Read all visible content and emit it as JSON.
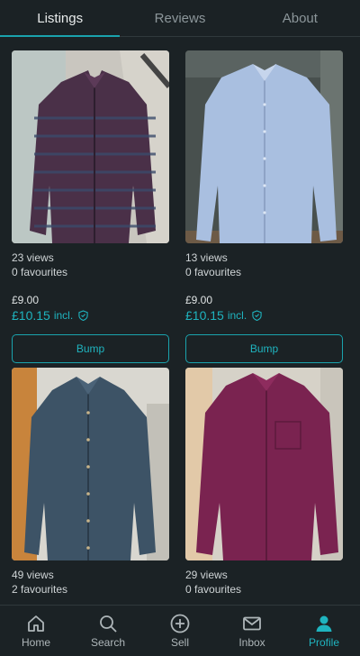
{
  "tabs": [
    {
      "label": "Listings",
      "active": true
    },
    {
      "label": "Reviews",
      "active": false
    },
    {
      "label": "About",
      "active": false
    }
  ],
  "listings": [
    {
      "views": "23 views",
      "favourites": "0 favourites",
      "price": "£9.00",
      "price_incl": "£10.15",
      "incl_label": "incl.",
      "bump_label": "Bump",
      "image": "shirt-burgundy-check",
      "shirt_color": "#4a3048"
    },
    {
      "views": "13 views",
      "favourites": "0 favourites",
      "price": "£9.00",
      "price_incl": "£10.15",
      "incl_label": "incl.",
      "bump_label": "Bump",
      "image": "shirt-light-blue",
      "shirt_color": "#a9bfe0"
    },
    {
      "views": "49 views",
      "favourites": "2 favourites",
      "image": "shirt-denim",
      "shirt_color": "#3d5366"
    },
    {
      "views": "29 views",
      "favourites": "0 favourites",
      "image": "shirt-magenta",
      "shirt_color": "#7a2350"
    }
  ],
  "nav": [
    {
      "label": "Home",
      "icon": "home-icon",
      "active": false
    },
    {
      "label": "Search",
      "icon": "search-icon",
      "active": false
    },
    {
      "label": "Sell",
      "icon": "plus-circle-icon",
      "active": false
    },
    {
      "label": "Inbox",
      "icon": "mail-icon",
      "active": false
    },
    {
      "label": "Profile",
      "icon": "profile-icon",
      "active": true
    }
  ],
  "colors": {
    "accent": "#1aa3ad",
    "background": "#1b2225"
  }
}
